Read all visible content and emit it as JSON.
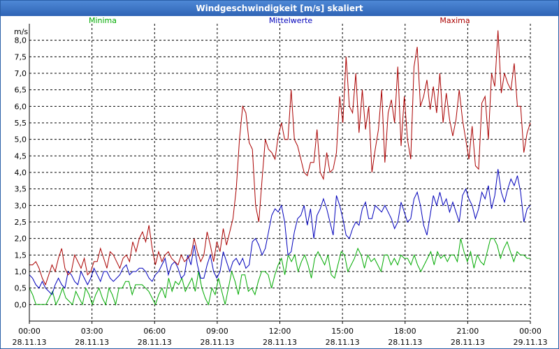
{
  "window": {
    "title": "Windgeschwindigkeit [m/s] skaliert"
  },
  "chart_data": {
    "type": "line",
    "title": "Windgeschwindigkeit [m/s] skaliert",
    "ylabel": "m/s",
    "ylim": [
      -0.5,
      8.5
    ],
    "yticks": [
      "0,0",
      "0,5",
      "1,0",
      "1,5",
      "2,0",
      "2,5",
      "3,0",
      "3,5",
      "4,0",
      "4,5",
      "5,0",
      "5,5",
      "6,0",
      "6,5",
      "7,0",
      "7,5",
      "8,0"
    ],
    "yticks_values": [
      0,
      0.5,
      1,
      1.5,
      2,
      2.5,
      3,
      3.5,
      4,
      4.5,
      5,
      5.5,
      6,
      6.5,
      7,
      7.5,
      8
    ],
    "xlim": [
      0,
      24
    ],
    "xticks_hours": [
      0,
      3,
      6,
      9,
      12,
      15,
      18,
      21,
      24
    ],
    "xticks_time": [
      "00:00",
      "03:00",
      "06:00",
      "09:00",
      "12:00",
      "15:00",
      "18:00",
      "21:00",
      "00:00"
    ],
    "xticks_date": [
      "28.11.13",
      "28.11.13",
      "28.11.13",
      "28.11.13",
      "28.11.13",
      "28.11.13",
      "28.11.13",
      "28.11.13",
      "29.11.13"
    ],
    "grid": true,
    "legend_placement": "top",
    "series": [
      {
        "name": "Minima",
        "color": "#00aa00",
        "values": [
          0.5,
          0.3,
          0.0,
          0.0,
          0.0,
          0.0,
          0.2,
          0.4,
          0.0,
          0.2,
          0.5,
          0.2,
          0.1,
          0.0,
          0.4,
          0.2,
          0.0,
          0.5,
          0.3,
          0.0,
          0.3,
          0.5,
          0.2,
          0.0,
          0.5,
          0.3,
          0.0,
          0.5,
          0.5,
          0.7,
          0.7,
          0.3,
          0.6,
          0.6,
          0.6,
          0.5,
          0.4,
          0.2,
          0.0,
          0.3,
          0.5,
          0.2,
          0.8,
          0.4,
          0.7,
          0.6,
          0.8,
          0.4,
          0.6,
          0.8,
          0.4,
          1.0,
          0.5,
          0.2,
          0.0,
          0.5,
          0.3,
          0.8,
          0.4,
          0.0,
          0.5,
          1.0,
          0.7,
          0.3,
          0.9,
          0.9,
          0.4,
          0.5,
          0.3,
          0.7,
          1.0,
          1.0,
          0.9,
          0.5,
          0.9,
          1.2,
          1.4,
          0.9,
          1.5,
          1.3,
          1.5,
          1.0,
          1.3,
          1.5,
          1.2,
          0.8,
          1.4,
          1.6,
          1.4,
          1.2,
          1.5,
          0.9,
          0.8,
          1.2,
          1.6,
          1.5,
          1.0,
          1.2,
          1.4,
          1.7,
          1.5,
          1.1,
          1.5,
          1.3,
          1.4,
          1.2,
          1.0,
          1.5,
          1.5,
          1.2,
          1.4,
          1.2,
          1.5,
          1.4,
          1.4,
          1.2,
          1.5,
          1.2,
          1.0,
          1.2,
          1.4,
          1.6,
          1.2,
          1.6,
          1.4,
          1.5,
          1.3,
          1.5,
          1.5,
          1.3,
          2.0,
          1.6,
          1.3,
          1.6,
          1.1,
          1.5,
          1.3,
          1.2,
          1.6,
          2.0,
          2.0,
          1.8,
          1.4,
          1.7,
          1.9,
          1.6,
          1.3,
          1.6,
          1.5,
          1.5,
          1.4,
          1.4
        ]
      },
      {
        "name": "Mittelwerte",
        "color": "#0000bb",
        "values": [
          0.9,
          0.8,
          0.6,
          0.5,
          0.7,
          0.5,
          0.4,
          0.3,
          0.6,
          0.8,
          0.6,
          0.5,
          1.0,
          0.9,
          0.7,
          0.6,
          1.0,
          0.8,
          0.6,
          0.8,
          1.1,
          0.9,
          0.7,
          1.0,
          1.0,
          0.8,
          0.7,
          0.8,
          0.9,
          1.1,
          1.2,
          0.9,
          1.0,
          1.0,
          1.1,
          1.1,
          1.0,
          0.8,
          0.7,
          0.9,
          1.0,
          1.2,
          1.4,
          0.9,
          1.2,
          1.3,
          1.1,
          0.8,
          0.9,
          1.5,
          1.2,
          1.8,
          1.2,
          0.8,
          0.8,
          1.2,
          1.5,
          1.0,
          0.8,
          1.0,
          1.6,
          1.3,
          1.0,
          1.3,
          1.4,
          1.2,
          1.4,
          1.1,
          1.2,
          1.9,
          2.0,
          1.8,
          1.5,
          1.7,
          2.2,
          2.7,
          2.9,
          2.8,
          3.0,
          2.5,
          1.5,
          1.6,
          2.2,
          2.6,
          2.7,
          3.0,
          2.4,
          2.9,
          2.0,
          2.7,
          2.9,
          3.2,
          2.9,
          2.5,
          2.1,
          3.3,
          3.0,
          2.6,
          2.1,
          2.0,
          2.3,
          2.5,
          2.4,
          2.9,
          3.1,
          2.6,
          2.6,
          3.0,
          2.9,
          2.8,
          3.0,
          2.8,
          2.6,
          2.3,
          2.5,
          3.1,
          2.8,
          2.5,
          2.6,
          3.2,
          3.4,
          3.0,
          2.4,
          2.1,
          2.7,
          3.3,
          3.0,
          3.4,
          3.0,
          3.2,
          2.8,
          3.1,
          2.8,
          2.5,
          3.3,
          3.5,
          3.2,
          3.0,
          2.6,
          2.9,
          3.4,
          3.2,
          3.6,
          2.9,
          3.3,
          4.1,
          3.4,
          3.1,
          3.5,
          3.8,
          3.6,
          3.9,
          3.4,
          2.5,
          2.9,
          3.0
        ]
      },
      {
        "name": "Maxima",
        "color": "#aa0000",
        "values": [
          1.2,
          1.2,
          1.3,
          1.1,
          0.8,
          0.6,
          0.9,
          1.2,
          1.0,
          1.4,
          1.7,
          1.1,
          0.9,
          1.0,
          1.5,
          1.3,
          1.1,
          1.4,
          0.9,
          1.0,
          1.3,
          1.3,
          1.7,
          1.4,
          1.1,
          1.6,
          1.5,
          1.3,
          1.1,
          1.4,
          1.5,
          1.3,
          1.9,
          1.6,
          2.0,
          2.2,
          1.9,
          2.4,
          1.7,
          1.2,
          1.6,
          1.3,
          1.5,
          1.6,
          1.4,
          1.3,
          1.2,
          1.5,
          1.3,
          1.4,
          1.5,
          2.0,
          1.6,
          1.3,
          1.5,
          2.2,
          1.8,
          1.3,
          1.9,
          1.6,
          2.3,
          1.8,
          2.2,
          2.6,
          3.5,
          5.0,
          6.0,
          5.8,
          4.9,
          4.7,
          3.0,
          2.5,
          3.8,
          5.0,
          4.7,
          4.6,
          4.4,
          5.1,
          5.5,
          5.0,
          5.0,
          6.5,
          5.0,
          4.8,
          4.4,
          4.0,
          3.9,
          4.3,
          4.3,
          5.3,
          4.0,
          3.8,
          4.6,
          4.0,
          4.1,
          4.6,
          6.3,
          5.5,
          7.5,
          6.0,
          5.8,
          7.0,
          5.2,
          6.5,
          5.3,
          6.0,
          4.0,
          4.7,
          5.3,
          6.5,
          4.3,
          5.8,
          6.2,
          5.5,
          7.2,
          4.8,
          6.3,
          5.0,
          4.4,
          7.2,
          7.8,
          6.0,
          6.3,
          6.8,
          5.9,
          6.6,
          5.8,
          7.0,
          5.5,
          6.4,
          5.6,
          5.1,
          5.6,
          6.5,
          5.6,
          5.0,
          4.4,
          5.4,
          4.2,
          4.1,
          6.1,
          6.3,
          5.0,
          7.0,
          6.6,
          8.3,
          6.4,
          7.0,
          6.7,
          6.5,
          7.3,
          6.0,
          6.0,
          4.6,
          5.2,
          5.5
        ]
      }
    ]
  }
}
